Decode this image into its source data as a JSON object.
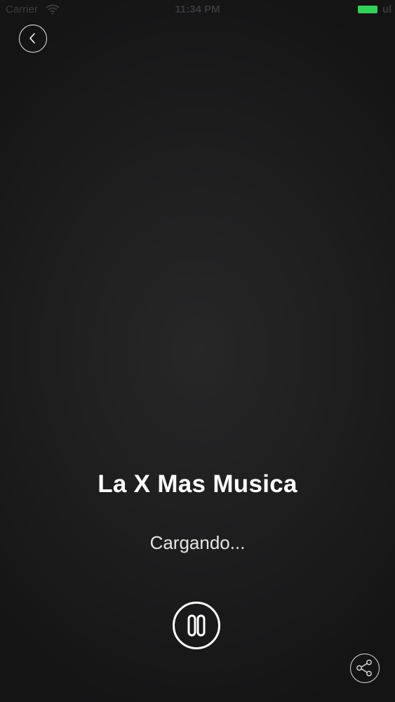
{
  "status_bar": {
    "carrier": "Carrier",
    "time": "11:34 PM",
    "battery_label": "ul",
    "battery_color": "#33d158",
    "icons": [
      "wifi-icon",
      "battery-icon"
    ]
  },
  "navigation": {
    "back_icon": "chevron-left-icon"
  },
  "player": {
    "station_name": "La X Mas Musica",
    "status": "Cargando...",
    "pause_icon": "pause-icon",
    "share_icon": "share-icon"
  },
  "colors": {
    "background": "#1d1d1e",
    "foreground": "#ffffff"
  }
}
